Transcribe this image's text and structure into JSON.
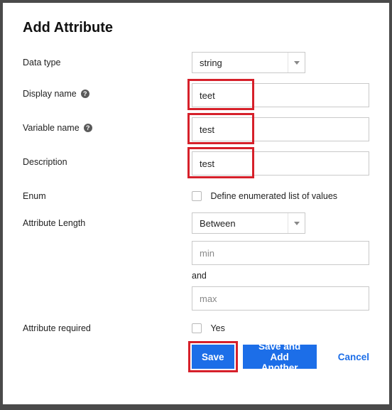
{
  "title": "Add Attribute",
  "labels": {
    "data_type": "Data type",
    "display_name": "Display name",
    "variable_name": "Variable name",
    "description": "Description",
    "enum": "Enum",
    "attribute_length": "Attribute Length",
    "attribute_required": "Attribute required"
  },
  "fields": {
    "data_type_value": "string",
    "display_name_value": "teet",
    "variable_name_value": "test",
    "description_value": "test",
    "enum_checkbox_label": "Define enumerated list of values",
    "length_mode_value": "Between",
    "min_placeholder": "min",
    "and_label": "and",
    "max_placeholder": "max",
    "required_checkbox_label": "Yes"
  },
  "buttons": {
    "save": "Save",
    "save_add_another": "Save and Add Another",
    "cancel": "Cancel"
  }
}
